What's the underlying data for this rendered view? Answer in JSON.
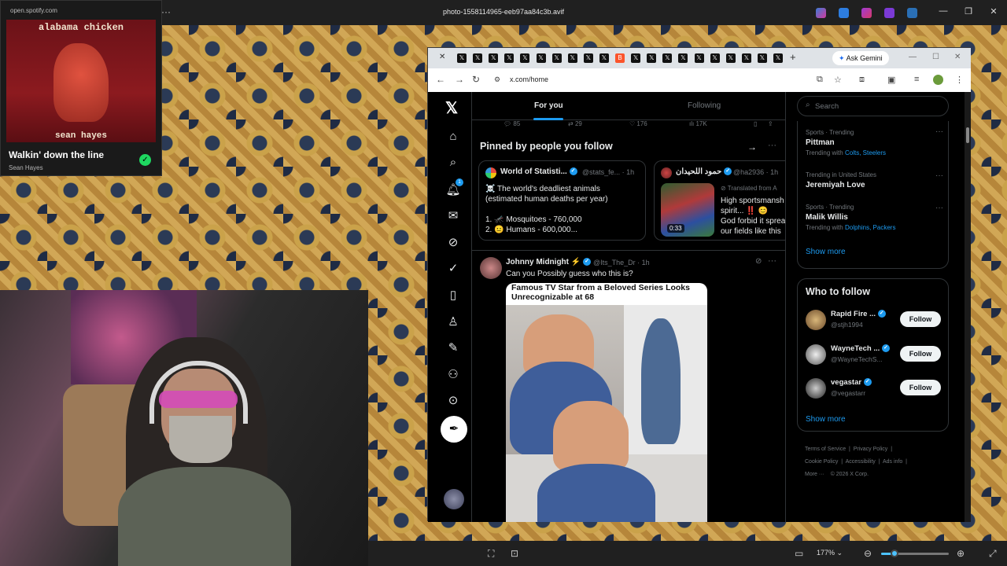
{
  "viewer": {
    "title": "photo-1558114965-eeb97aa84c3b.avif",
    "zoom": "177%",
    "zoom_fraction": 0.2,
    "win_minimize": "—",
    "win_restore": "❐",
    "win_close": "✕"
  },
  "spotify": {
    "url": "open.spotify.com",
    "album_title": "alabama chicken",
    "album_artist": "sean hayes",
    "track": "Walkin' down the line",
    "artist": "Sean Hayes"
  },
  "browser": {
    "url": "x.com/home",
    "ask_gemini": "Ask Gemini",
    "tab_count": 21
  },
  "x": {
    "tabs": [
      "For you",
      "Following"
    ],
    "action_counts": [
      "85",
      "29",
      "176",
      "17K"
    ],
    "pinned_title": "Pinned by people you follow",
    "pinned_cards": [
      {
        "name": "World of Statisti...",
        "handle": "@stats_fe... · 1h",
        "lines": [
          "☠️ The world's deadliest animals",
          "(estimated human deaths per year)",
          "",
          "1.  🦟 Mosquitoes - 760,000",
          "2.  😐 Humans - 600,000..."
        ]
      },
      {
        "name": "حمود اللحيدان",
        "handle": "@ha2936 · 1h",
        "translated": "Translated from A",
        "lines": [
          "High sportsmansh",
          "spirit... ‼️ 😊",
          "God forbid it sprea",
          "our fields like this"
        ],
        "duration": "0:33"
      }
    ],
    "tweet": {
      "name": "Johnny Midnight ⚡",
      "handle": "@Its_The_Dr · 1h",
      "text": "Can you Possibly guess who this is?",
      "image_caption": "Famous TV Star from a Beloved Series Looks Unrecognizable at 68"
    },
    "search_placeholder": "Search",
    "trends": [
      {
        "category": "Sports · Trending",
        "name": "Pittman",
        "with_label": "Trending with",
        "links": "Colts, Steelers"
      },
      {
        "category": "Trending in United States",
        "name": "Jeremiyah Love",
        "with_label": "",
        "links": ""
      },
      {
        "category": "Sports · Trending",
        "name": "Malik Willis",
        "with_label": "Trending with",
        "links": "Dolphins, Packers"
      }
    ],
    "show_more": "Show more",
    "who_to_follow": "Who to follow",
    "follow_suggestions": [
      {
        "name": "Rapid Fire ...",
        "handle": "@stjh1994"
      },
      {
        "name": "WayneTech ...",
        "handle": "@WayneTechS..."
      },
      {
        "name": "vegastar",
        "handle": "@vegastarr"
      }
    ],
    "follow_label": "Follow",
    "footer": [
      "Terms of Service",
      "Privacy Policy",
      "Cookie Policy",
      "Accessibility",
      "Ads info",
      "More ···",
      "© 2026 X Corp."
    ]
  }
}
